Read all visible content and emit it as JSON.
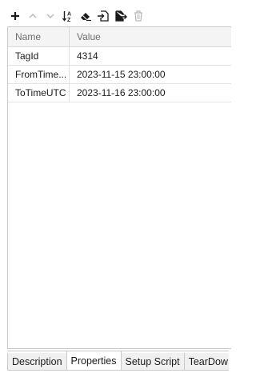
{
  "toolbar": {
    "buttons": [
      {
        "icon": "plus-icon",
        "enabled": true
      },
      {
        "icon": "move-up-icon",
        "enabled": false
      },
      {
        "icon": "move-down-icon",
        "enabled": false
      },
      {
        "icon": "sort-az-icon",
        "enabled": true
      },
      {
        "icon": "eraser-icon",
        "enabled": true
      },
      {
        "icon": "import-icon",
        "enabled": true
      },
      {
        "icon": "export-icon",
        "enabled": true
      },
      {
        "icon": "trash-icon",
        "enabled": false
      }
    ]
  },
  "grid": {
    "headers": {
      "name": "Name",
      "value": "Value"
    },
    "rows": [
      {
        "name": "TagId",
        "value": "4314"
      },
      {
        "name": "FromTime...",
        "value": "2023-11-15 23:00:00"
      },
      {
        "name": "ToTimeUTC",
        "value": "2023-11-16 23:00:00"
      }
    ]
  },
  "tabs": [
    {
      "label": "Description",
      "active": false
    },
    {
      "label": "Properties",
      "active": true
    },
    {
      "label": "Setup Script",
      "active": false
    },
    {
      "label": "TearDow",
      "active": false
    }
  ],
  "colors": {
    "icon_enabled": "#1a1a1a",
    "icon_disabled": "#b8b8b8"
  }
}
